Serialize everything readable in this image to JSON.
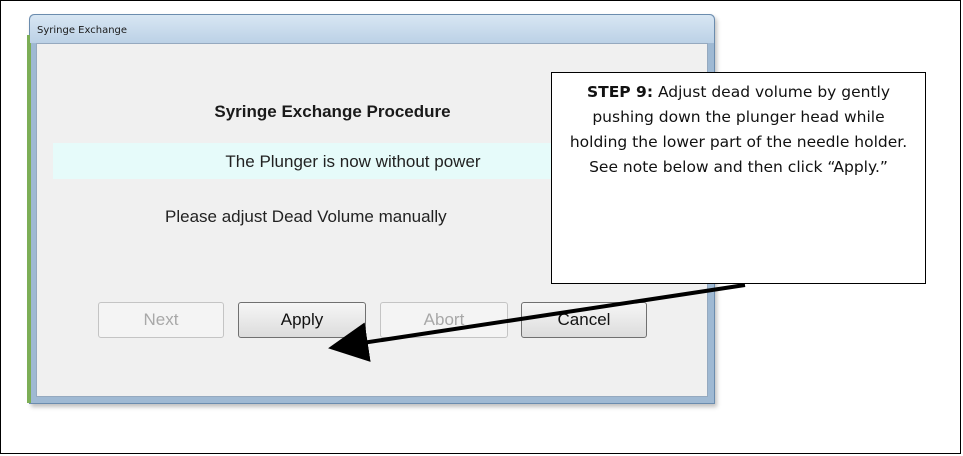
{
  "dialog": {
    "title": "Syringe Exchange",
    "procedure_title": "Syringe Exchange Procedure",
    "status_message": "The Plunger is now without power",
    "instruction": "Please adjust Dead Volume manually",
    "buttons": {
      "next": "Next",
      "apply": "Apply",
      "abort": "Abort",
      "cancel": "Cancel"
    }
  },
  "callout": {
    "step_label": "STEP 9:",
    "text": " Adjust dead volume by gently pushing down the plunger head while holding the lower part of the needle holder. See note below and then click “Apply.”"
  },
  "colors": {
    "status_bg": "#e6fbfa",
    "dialog_frame": "#9fb9d3",
    "accent_green": "#7cae56"
  }
}
